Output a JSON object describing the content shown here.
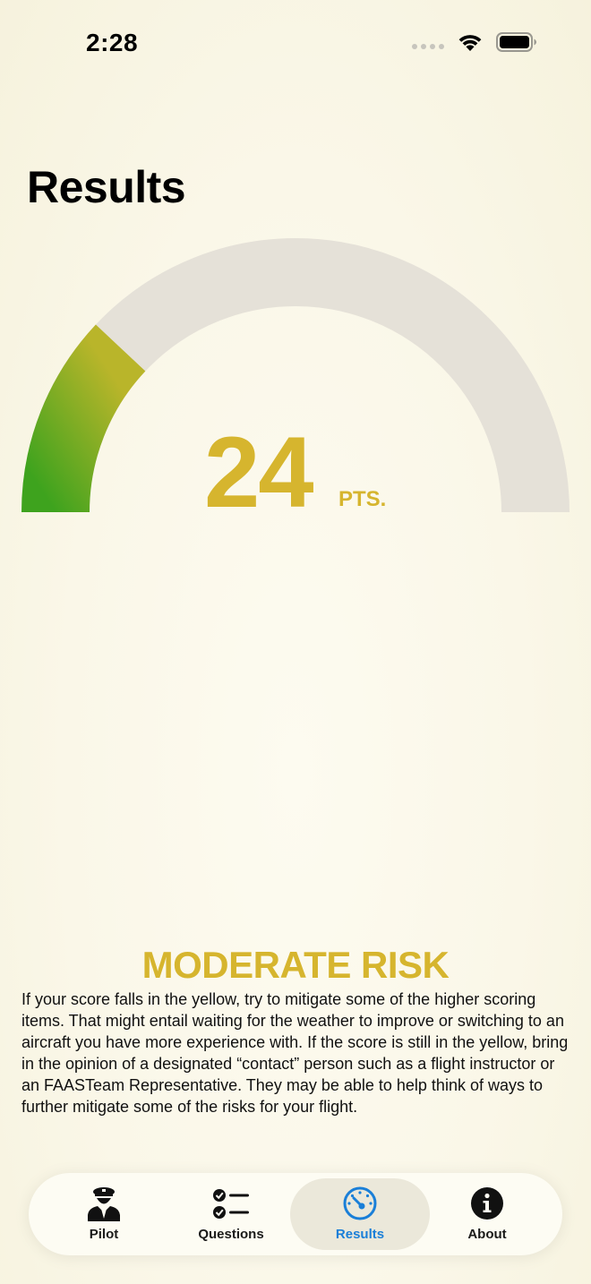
{
  "status_bar": {
    "time": "2:28"
  },
  "page": {
    "title": "Results"
  },
  "score": {
    "value": "24",
    "unit": "PTS.",
    "fraction": 0.24
  },
  "risk": {
    "title": "MODERATE RISK",
    "description": "If your score falls in the yellow, try to mitigate some of the higher scoring items. That might entail waiting for the weather to improve or switching to an aircraft you have more experience with. If the score is still in the yellow, bring in the opinion of a designated “contact” person such as a flight instructor or an FAASTeam Representative. They may be able to help think of ways to further mitigate some of the risks for your flight."
  },
  "colors": {
    "score": "#d6b52e",
    "gauge_track": "#e5e1d8",
    "gauge_start": "#3ea31e",
    "gauge_end": "#b9b52a",
    "active_tab": "#1a7fd8"
  },
  "tabs": [
    {
      "label": "Pilot",
      "icon": "pilot-icon",
      "active": false
    },
    {
      "label": "Questions",
      "icon": "checklist-icon",
      "active": false
    },
    {
      "label": "Results",
      "icon": "gauge-icon",
      "active": true
    },
    {
      "label": "About",
      "icon": "info-icon",
      "active": false
    }
  ]
}
